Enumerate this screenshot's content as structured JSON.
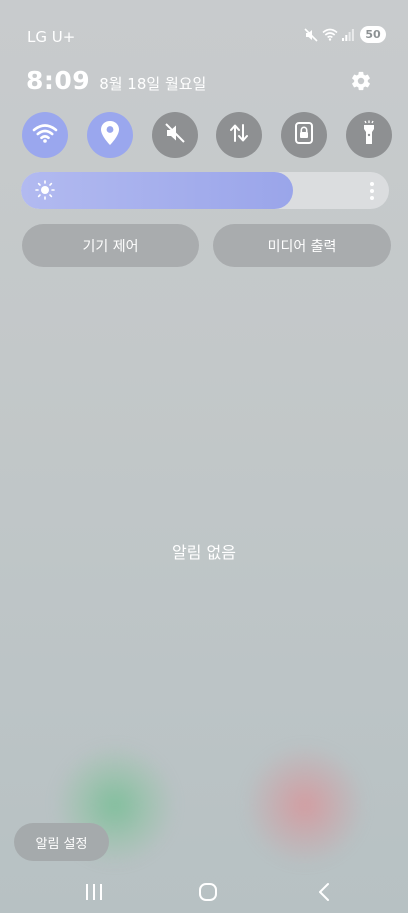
{
  "status_bar": {
    "carrier": "LG U+",
    "battery_level": "50",
    "icons": [
      "mute-icon",
      "wifi-icon",
      "signal-icon",
      "battery-icon"
    ]
  },
  "header": {
    "time": "8:09",
    "date": "8월 18일 월요일"
  },
  "quick_settings": {
    "tiles": [
      {
        "name": "wifi",
        "icon": "wifi-icon",
        "active": true
      },
      {
        "name": "location",
        "icon": "location-pin-icon",
        "active": true
      },
      {
        "name": "sound",
        "icon": "mute-icon",
        "active": false
      },
      {
        "name": "mobile-data",
        "icon": "data-transfer-icon",
        "active": false
      },
      {
        "name": "screen-lock",
        "icon": "lock-icon",
        "active": false
      },
      {
        "name": "flashlight",
        "icon": "flashlight-icon",
        "active": false
      }
    ],
    "brightness_level": 0.74,
    "device_control_label": "기기 제어",
    "media_output_label": "미디어 출력"
  },
  "notifications": {
    "empty_message": "알림 없음",
    "settings_label": "알림 설정"
  },
  "colors": {
    "accent": "#9aa7ee",
    "tile_off": "#8e9092"
  },
  "nav_bar": {
    "buttons": [
      "recent-apps-icon",
      "home-icon",
      "back-icon"
    ]
  }
}
